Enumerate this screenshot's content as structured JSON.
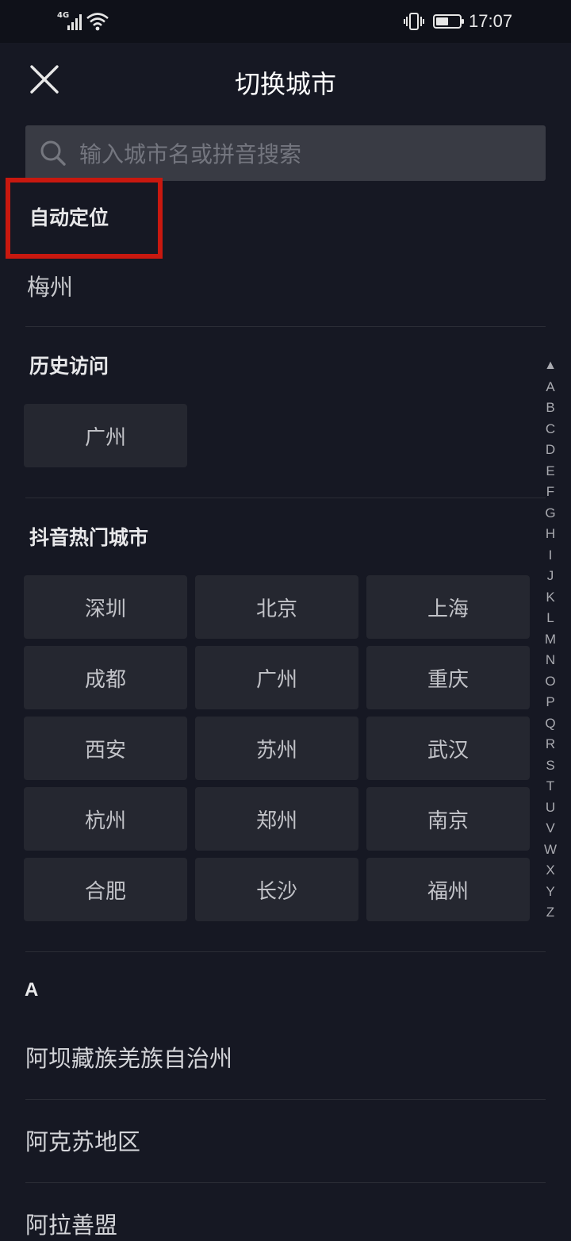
{
  "status_bar": {
    "network": "4G",
    "time": "17:07"
  },
  "header": {
    "title": "切换城市"
  },
  "search": {
    "placeholder": "输入城市名或拼音搜索"
  },
  "auto_location": {
    "heading": "自动定位",
    "city": "梅州"
  },
  "history": {
    "heading": "历史访问",
    "cities": [
      "广州"
    ]
  },
  "hot": {
    "heading": "抖音热门城市",
    "cities": [
      "深圳",
      "北京",
      "上海",
      "成都",
      "广州",
      "重庆",
      "西安",
      "苏州",
      "武汉",
      "杭州",
      "郑州",
      "南京",
      "合肥",
      "长沙",
      "福州"
    ]
  },
  "list": {
    "letter": "A",
    "cities": [
      "阿坝藏族羌族自治州",
      "阿克苏地区",
      "阿拉善盟"
    ]
  },
  "index": [
    "▲",
    "A",
    "B",
    "C",
    "D",
    "E",
    "F",
    "G",
    "H",
    "I",
    "J",
    "K",
    "L",
    "M",
    "N",
    "O",
    "P",
    "Q",
    "R",
    "S",
    "T",
    "U",
    "V",
    "W",
    "X",
    "Y",
    "Z"
  ],
  "colors": {
    "background": "#161823",
    "button": "#252730",
    "search_bg": "#393b44",
    "highlight": "#c8180f"
  }
}
